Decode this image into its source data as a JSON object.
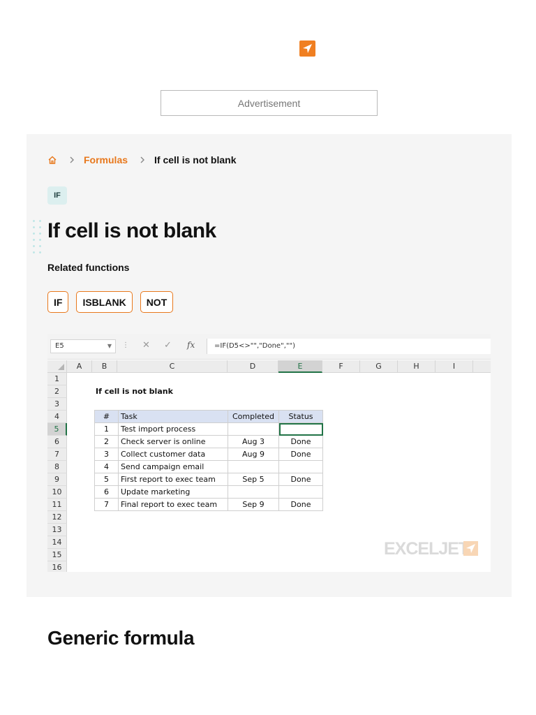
{
  "ad": {
    "label": "Advertisement"
  },
  "breadcrumb": {
    "section": "Formulas",
    "current": "If cell is not blank"
  },
  "tag": "IF",
  "page_title": "If cell is not blank",
  "related": {
    "label": "Related functions",
    "functions": [
      "IF",
      "ISBLANK",
      "NOT"
    ]
  },
  "sheet": {
    "name_box": "E5",
    "formula": "=IF(D5<>\"\",\"Done\",\"\")",
    "columns": [
      "A",
      "B",
      "C",
      "D",
      "E",
      "F",
      "G",
      "H",
      "I"
    ],
    "selected_column": "E",
    "rows": [
      "1",
      "2",
      "3",
      "4",
      "5",
      "6",
      "7",
      "8",
      "9",
      "10",
      "11",
      "12",
      "13",
      "14",
      "15",
      "16"
    ],
    "selected_row": "5",
    "title": "If cell is not blank",
    "headers": [
      "#",
      "Task",
      "Completed",
      "Status"
    ],
    "data": [
      [
        "1",
        "Test import process",
        "",
        ""
      ],
      [
        "2",
        "Check server is online",
        "Aug 3",
        "Done"
      ],
      [
        "3",
        "Collect customer data",
        "Aug 9",
        "Done"
      ],
      [
        "4",
        "Send campaign email",
        "",
        ""
      ],
      [
        "5",
        "First report to exec team",
        "Sep 5",
        "Done"
      ],
      [
        "6",
        "Update marketing",
        "",
        ""
      ],
      [
        "7",
        "Final report to exec team",
        "Sep 9",
        "Done"
      ]
    ],
    "watermark": "EXCELJET"
  },
  "generic_heading": "Generic formula",
  "colors": {
    "accent": "#e8781c",
    "excel_green": "#217346",
    "header_fill": "#d9e1f2"
  }
}
